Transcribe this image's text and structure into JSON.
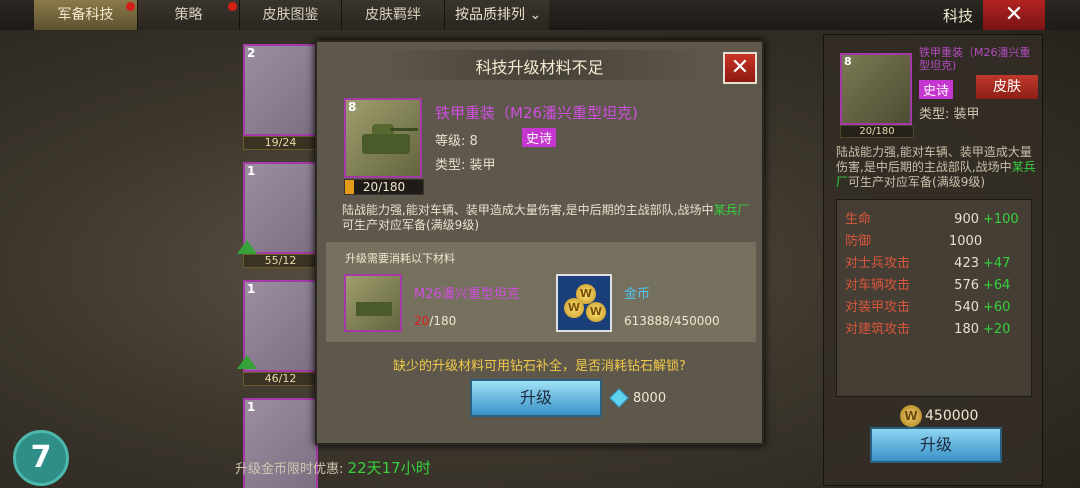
{
  "tabs": [
    {
      "label": "军备科技",
      "active": true,
      "dot": true
    },
    {
      "label": "策略",
      "active": false,
      "dot": true
    },
    {
      "label": "皮肤图鉴",
      "active": false,
      "dot": false
    },
    {
      "label": "皮肤羁绊",
      "active": false,
      "dot": false
    }
  ],
  "sort_label": "按品质排列",
  "header_title": "科技",
  "close_glyph": "✕",
  "left_cards": [
    {
      "level": "2",
      "progress": "19/24"
    },
    {
      "level": "1",
      "progress": "55/12"
    },
    {
      "level": "1",
      "progress": "46/12"
    },
    {
      "level": "1",
      "progress": ""
    }
  ],
  "help_badge": "7",
  "limited": {
    "label": "升级金币限时优惠:",
    "time": "22天17小时"
  },
  "dialog": {
    "title": "科技升级材料不足",
    "close": "✕",
    "unit": {
      "level": "8",
      "name": "铁甲重装（M26潘兴重型坦克)",
      "level_text": "等级: 8",
      "tier": "史诗",
      "type_text": "类型:  装甲",
      "progress": "20/180",
      "progress_fraction": 0.11,
      "desc": "陆战能力强,能对车辆、装甲造成大量伤害,是中后期的主战部队,战场中",
      "desc_highlight": "某兵厂",
      "desc_tail": "可生产对应军备(满级9级)"
    },
    "materials_label": "升级需要消耗以下材料",
    "materials": [
      {
        "name": "M26潘兴重型坦克",
        "have": "20",
        "need": "/180"
      },
      {
        "name": "金币",
        "count": "613888/450000"
      }
    ],
    "ask": "缺少的升级材料可用钻石补全，是否消耗钻石解锁?",
    "upgrade": "升级",
    "diamond_cost": "8000"
  },
  "right_panel": {
    "level": "8",
    "name": "铁甲重装（M26潘兴重型坦克)",
    "tier": "史诗",
    "skin": "皮肤",
    "type_text": "类型:  装甲",
    "progress": "20/180",
    "desc": "陆战能力强,能对车辆、装甲造成大量伤害,是中后期的主战部队,战场中",
    "desc_highlight": "某兵厂",
    "desc_tail": "可生产对应军备(满级9级)",
    "stats": [
      {
        "key": "生命",
        "value": "900",
        "bonus": "+100"
      },
      {
        "key": "防御",
        "value": "1000",
        "bonus": ""
      },
      {
        "key": "对士兵攻击",
        "value": "423",
        "bonus": "+47"
      },
      {
        "key": "对车辆攻击",
        "value": "576",
        "bonus": "+64"
      },
      {
        "key": "对装甲攻击",
        "value": "540",
        "bonus": "+60"
      },
      {
        "key": "对建筑攻击",
        "value": "180",
        "bonus": "+20"
      }
    ],
    "coin_glyph": "W",
    "coin_cost": "450000",
    "upgrade": "升级"
  }
}
